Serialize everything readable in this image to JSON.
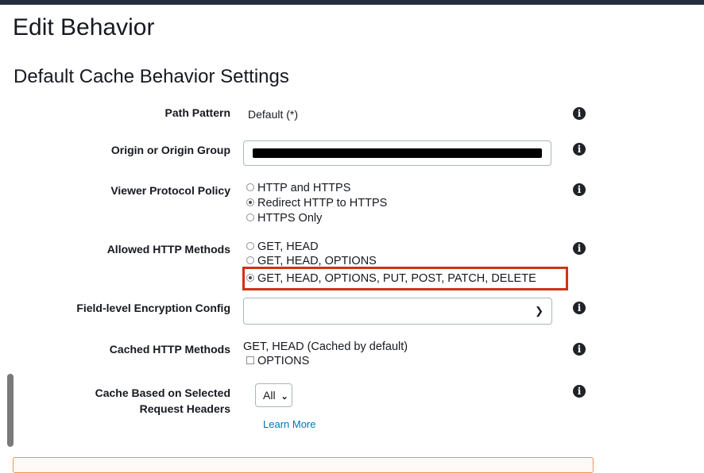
{
  "page": {
    "title": "Edit Behavior",
    "section_title": "Default Cache Behavior Settings"
  },
  "path_pattern": {
    "label": "Path Pattern",
    "value": "Default (*)"
  },
  "origin": {
    "label": "Origin or Origin Group",
    "value": ""
  },
  "viewer_protocol_policy": {
    "label": "Viewer Protocol Policy",
    "options": [
      {
        "label": "HTTP and HTTPS",
        "selected": false
      },
      {
        "label": "Redirect HTTP to HTTPS",
        "selected": true
      },
      {
        "label": "HTTPS Only",
        "selected": false
      }
    ]
  },
  "allowed_http_methods": {
    "label": "Allowed HTTP Methods",
    "options": [
      {
        "label": "GET, HEAD",
        "selected": false
      },
      {
        "label": "GET, HEAD, OPTIONS",
        "selected": false
      },
      {
        "label": "GET, HEAD, OPTIONS, PUT, POST, PATCH, DELETE",
        "selected": true
      }
    ],
    "highlight_color": "#d13212"
  },
  "field_level_encryption": {
    "label": "Field-level Encryption Config",
    "selected": ""
  },
  "cached_http_methods": {
    "label": "Cached HTTP Methods",
    "default_text": "GET, HEAD (Cached by default)",
    "options_checkbox": {
      "label": "OPTIONS",
      "checked": false
    }
  },
  "cache_headers": {
    "label_line1": "Cache Based on Selected",
    "label_line2": "Request Headers",
    "dropdown": "All",
    "learn_more": "Learn More"
  },
  "icons": {
    "info": "info-icon",
    "chevron": "chevron-down-icon"
  },
  "colors": {
    "link": "#0073bb",
    "alert_border": "#f89256",
    "topbar": "#232f3e"
  }
}
